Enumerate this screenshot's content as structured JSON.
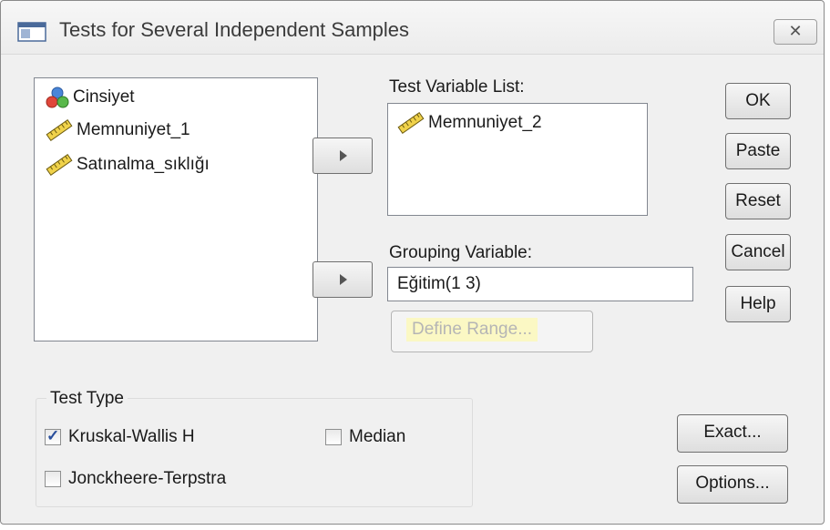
{
  "window": {
    "title": "Tests for Several Independent Samples",
    "close_label": "✕"
  },
  "source_list": {
    "items": [
      {
        "label": "Cinsiyet",
        "icon": "nominal-variable-icon"
      },
      {
        "label": "Memnuniyet_1",
        "icon": "scale-variable-icon"
      },
      {
        "label": "Satınalma_sıklığı",
        "icon": "scale-variable-icon"
      }
    ]
  },
  "test_variable_list": {
    "label": "Test Variable List:",
    "items": [
      {
        "label": "Memnuniyet_2",
        "icon": "scale-variable-icon"
      }
    ]
  },
  "grouping": {
    "label": "Grouping Variable:",
    "value": "Eğitim(1 3)",
    "define_range_label": "Define Range..."
  },
  "side_buttons": {
    "ok": "OK",
    "paste": "Paste",
    "reset": "Reset",
    "cancel": "Cancel",
    "help": "Help"
  },
  "test_type": {
    "legend": "Test Type",
    "kruskal_wallis": {
      "label": "Kruskal-Wallis H",
      "checked": true
    },
    "median": {
      "label": "Median",
      "checked": false
    },
    "jonckheere": {
      "label": "Jonckheere-Terpstra",
      "checked": false
    }
  },
  "bottom_buttons": {
    "exact": "Exact...",
    "options": "Options..."
  },
  "colors": {
    "highlight": "#fbf8c4",
    "checkmark": "#2a4f9c"
  }
}
